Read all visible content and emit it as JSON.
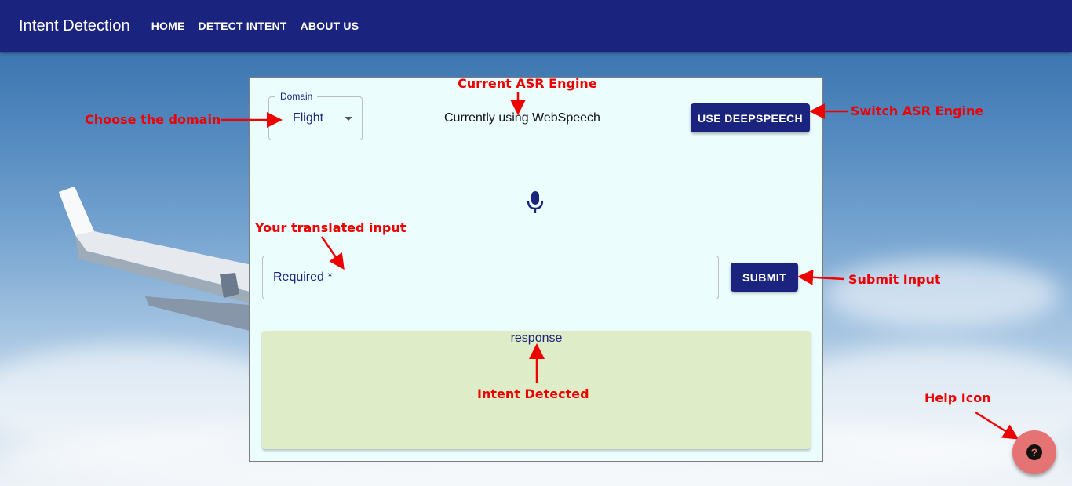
{
  "app": {
    "title": "Intent Detection",
    "nav": [
      {
        "label": "HOME"
      },
      {
        "label": "DETECT INTENT"
      },
      {
        "label": "ABOUT US"
      }
    ]
  },
  "form": {
    "domain": {
      "label": "Domain",
      "value": "Flight"
    },
    "asr_status": "Currently using WebSpeech",
    "switch_button": "USE DEEPSPEECH",
    "input_label": "Required *",
    "submit_button": "SUBMIT",
    "response": "response"
  },
  "annotations": {
    "choose_domain": "Choose the domain",
    "current_asr": "Current ASR Engine",
    "switch_asr": "Switch ASR Engine",
    "translated_input": "Your translated input",
    "submit_input": "Submit Input",
    "intent_detected": "Intent Detected",
    "help_icon": "Help Icon"
  },
  "icons": {
    "mic": "mic-icon",
    "help": "help-circle-icon",
    "caret": "caret-down-icon"
  },
  "colors": {
    "primary": "#1a237e",
    "annotation": "#ee0000",
    "help_fab": "#e57373",
    "response_bg": "#deedc8",
    "card_bg": "#ecfdfe"
  }
}
